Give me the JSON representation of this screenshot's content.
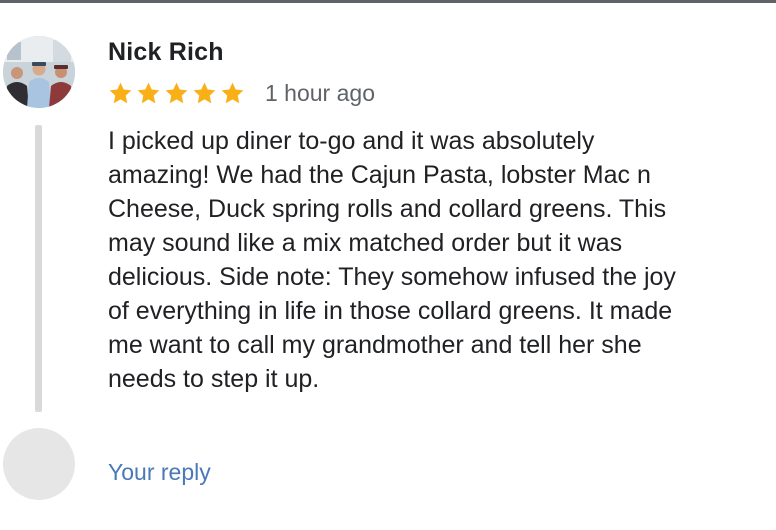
{
  "review": {
    "author": "Nick Rich",
    "avatar_icon": "profile-photo-three-people",
    "rating": 5,
    "rating_max": 5,
    "star_color": "#F9B017",
    "timestamp": "1 hour ago",
    "text": "I picked up diner to-go and it was absolutely\namazing! We had the Cajun Pasta, lobster Mac n\nCheese, Duck spring rolls and collard greens. This\nmay sound like a mix matched order but it was\ndelicious. Side note: They somehow infused the joy\nof everything in life in those collard greens. It made\nme want to call my grandmother and tell her she\nneeds to step it up."
  },
  "reply": {
    "avatar_icon": "blank-user-avatar",
    "link_label": "Your reply",
    "link_color": "#4A78B8"
  }
}
